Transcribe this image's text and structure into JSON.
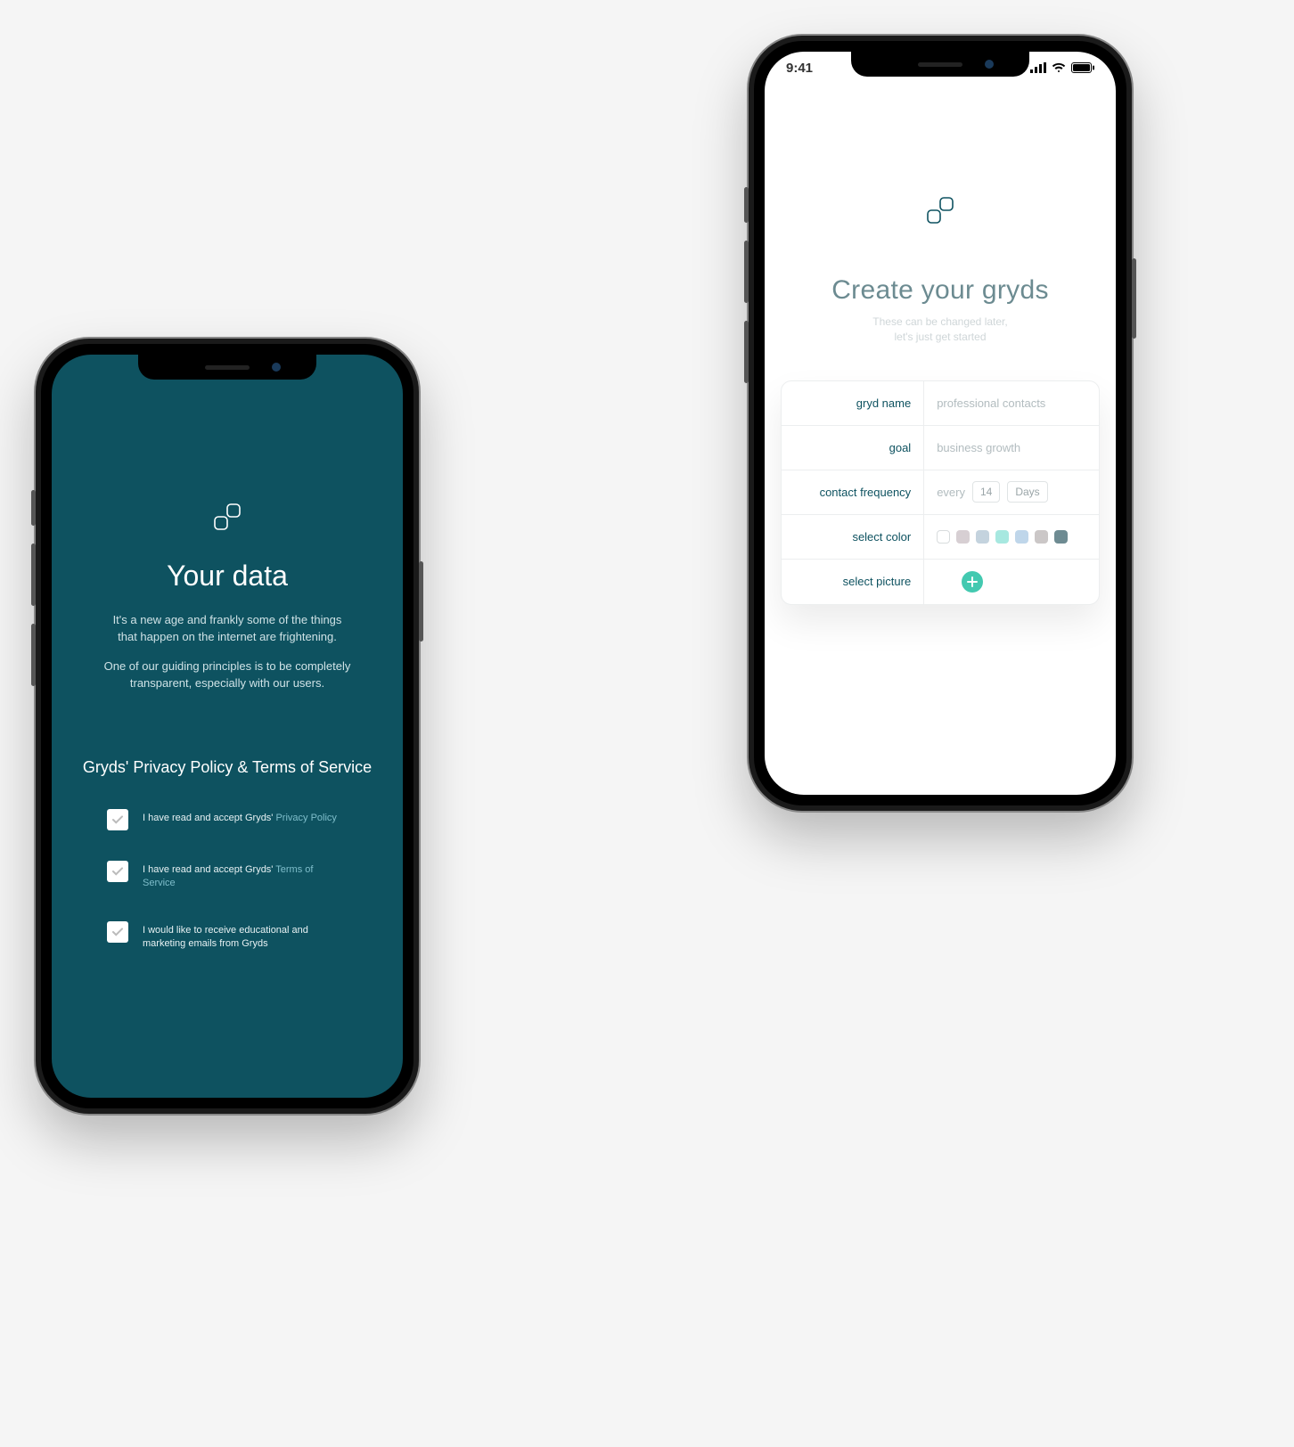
{
  "left": {
    "title": "Your data",
    "para1": "It's a new age and frankly some of the things that happen on the internet are frightening.",
    "para2": "One of our guiding principles is to be completely transparent, especially with our users.",
    "subhead": "Gryds' Privacy Policy & Terms of Service",
    "checks": [
      {
        "pre": "I have read and accept Gryds' ",
        "link": "Privacy Policy"
      },
      {
        "pre": "I have read and accept Gryds' ",
        "link": "Terms of Service"
      },
      {
        "pre": "I would like to receive educational and marketing emails from Gryds",
        "link": ""
      }
    ]
  },
  "right": {
    "status_time": "9:41",
    "title": "Create your gryds",
    "hint1": "These can be changed later,",
    "hint2": "let's just get started",
    "rows": {
      "name_label": "gryd name",
      "name_placeholder": "professional contacts",
      "goal_label": "goal",
      "goal_placeholder": "business growth",
      "freq_label": "contact frequency",
      "freq_prefix": "every",
      "freq_number": "14",
      "freq_unit": "Days",
      "color_label": "select color",
      "picture_label": "select picture"
    },
    "colors": [
      "#ffffff",
      "#d7cfd3",
      "#c4d3de",
      "#a7e8e0",
      "#bfd6ea",
      "#cbc7c7",
      "#6e8b92"
    ]
  }
}
